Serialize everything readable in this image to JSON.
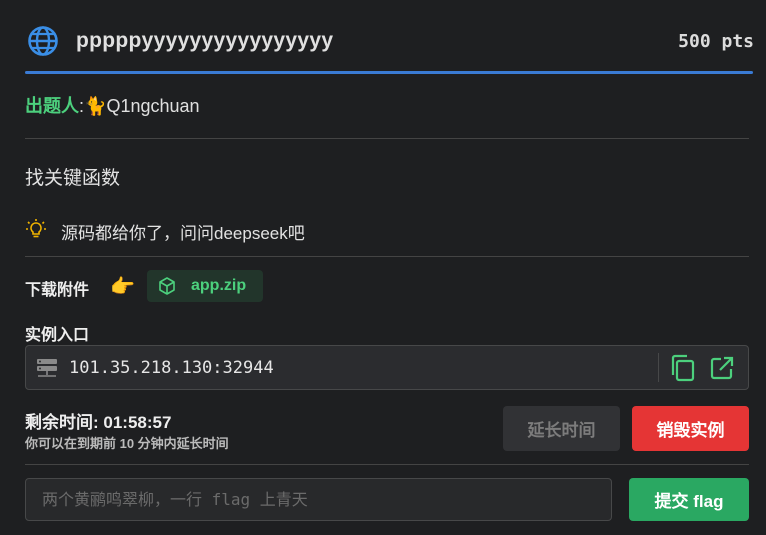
{
  "challenge": {
    "title": "pppppyyyyyyyyyyyyyyyy",
    "points": "500 pts"
  },
  "author": {
    "label": "出题人",
    "separator": ":",
    "avatar_emoji": "🐈",
    "name": "Q1ngchuan"
  },
  "description": "找关键函数",
  "hint": {
    "icon": "lightbulb-icon",
    "text": "源码都给你了，问问deepseek吧"
  },
  "attachments": {
    "label": "下载附件",
    "hand_emoji": "👉",
    "file_icon": "package-icon",
    "file_name": "app.zip"
  },
  "instance": {
    "label": "实例入口",
    "address": "101.35.218.130:32944",
    "icons": [
      "server-icon",
      "copy-icon",
      "external-link-icon"
    ]
  },
  "timer": {
    "label": "剩余时间: ",
    "value": "01:58:57",
    "note": "你可以在到期前 10 分钟内延长时间"
  },
  "buttons": {
    "extend": "延长时间",
    "destroy": "销毁实例",
    "submit": "提交 flag"
  },
  "flag_input": {
    "value": "",
    "placeholder": "两个黄鹂鸣翠柳，一行 flag 上青天"
  },
  "colors": {
    "accent_blue": "#3a7bd5",
    "green": "#4cd07d",
    "danger": "#e53535",
    "submit_green": "#2aa862"
  }
}
